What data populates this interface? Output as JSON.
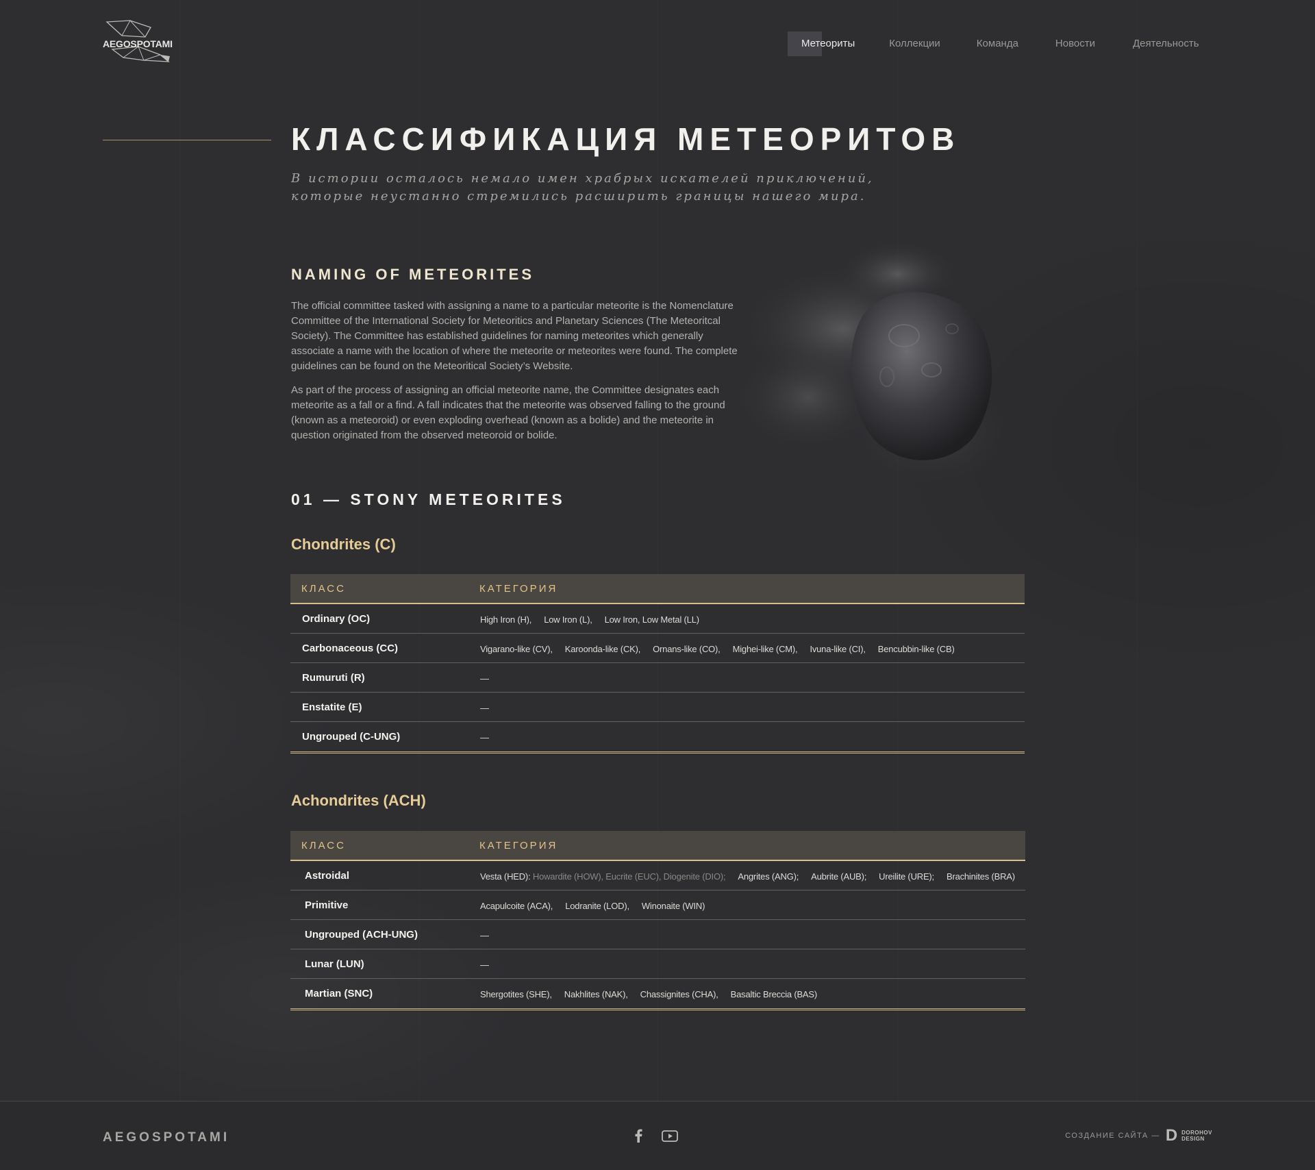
{
  "brand": {
    "logo_text": "AEGOSPOTAMI"
  },
  "nav": {
    "items": [
      {
        "label": "Метеориты"
      },
      {
        "label": "Коллекции"
      },
      {
        "label": "Команда"
      },
      {
        "label": "Новости"
      },
      {
        "label": "Деятельность"
      }
    ]
  },
  "hero": {
    "title": "КЛАССИФИКАЦИЯ МЕТЕОРИТОВ",
    "subtitle_line1": "В истории осталось немало имен храбрых искателей приключений,",
    "subtitle_line2": "которые неустанно стремились расширить границы нашего мира."
  },
  "naming": {
    "title": "NAMING OF METEORITES",
    "paragraph1": "The official committee tasked with assigning a name to a particular meteorite is the Nomenclature Committee of the International Society for Meteoritics and Planetary Sciences (The Meteoritcal Society). The Committee has established guidelines for naming meteorites which generally associate a name with the location of where the meteorite or meteorites were found. The complete guidelines can be found on the Meteoritical Society’s Website.",
    "paragraph2": "As part of the process of assigning an official meteorite name, the Committee designates each meteorite as a fall or a find. A fall indicates that the meteorite was observed falling to the ground (known as a meteoroid) or even exploding overhead (known as a bolide) and the meteorite in question originated from the observed meteoroid or bolide."
  },
  "section": {
    "title": "01 — STONY METEORITES"
  },
  "chondrites": {
    "title": "Chondrites (C)",
    "head_class": "КЛАСС",
    "head_category": "КАТЕГОРИЯ",
    "rows": [
      {
        "cls": "Ordinary (OC)",
        "cats": [
          "High Iron (H),",
          "Low Iron (L),",
          "Low Iron, Low Metal (LL)"
        ]
      },
      {
        "cls": "Carbonaceous (CC)",
        "cats": [
          "Vigarano-like (CV),",
          "Karoonda-like (CK),",
          "Ornans-like (CO),",
          "Mighei-like (CM),",
          "Ivuna-like (CI),",
          "Bencubbin-like (CB)"
        ]
      },
      {
        "cls": "Rumuruti (R)",
        "cats": [
          "—"
        ]
      },
      {
        "cls": "Enstatite (E)",
        "cats": [
          "—"
        ]
      },
      {
        "cls": "Ungrouped (C-UNG)",
        "cats": [
          "—"
        ]
      }
    ]
  },
  "achondrites": {
    "title": "Achondrites (ACH)",
    "head_class": "КЛАСС",
    "head_category": "КАТЕГОРИЯ",
    "astroidal": {
      "cls": "Astroidal",
      "vesta": "Vesta (HED):",
      "vesta_sub": "Howardite (HOW), Eucrite (EUC), Diogenite (DIO);",
      "rest": [
        "Angrites (ANG);",
        "Aubrite (AUB);",
        "Ureilite (URE);",
        "Brachinites (BRA)"
      ]
    },
    "rows": [
      {
        "cls": "Primitive",
        "cats": [
          "Acapulcoite (ACA),",
          "Lodranite (LOD),",
          "Winonaite (WIN)"
        ]
      },
      {
        "cls": "Ungrouped (ACH-UNG)",
        "cats": [
          "—"
        ]
      },
      {
        "cls": "Lunar (LUN)",
        "cats": [
          "—"
        ]
      },
      {
        "cls": "Martian (SNC)",
        "cats": [
          "Shergotites (SHE),",
          "Nakhlites (NAK),",
          "Chassignites (CHA),",
          "Basaltic Breccia (BAS)"
        ]
      }
    ]
  },
  "footer": {
    "brand": "AEGOSPOTAMI",
    "credit": "СОЗДАНИЕ САЙТА —",
    "studio_mark": "D",
    "studio_line1": "DOROHOV",
    "studio_line2": "DESIGN",
    "social": [
      "facebook-icon",
      "youtube-icon"
    ]
  },
  "colors": {
    "background": "#2e2e31",
    "accent": "#e6cd97",
    "table_head": "#4a4642"
  }
}
